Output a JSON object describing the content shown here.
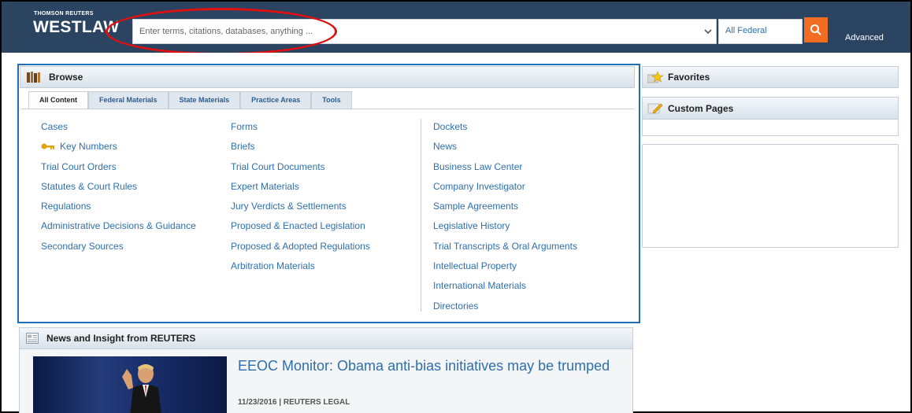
{
  "header": {
    "brand_top": "THOMSON REUTERS",
    "brand_main": "WESTLAW",
    "search_placeholder": "Enter terms, citations, databases, anything ...",
    "jurisdiction": "All Federal",
    "advanced_label": "Advanced",
    "colors": {
      "bar": "#2b4461",
      "search_button": "#f26d21",
      "annotation": "#e01010"
    }
  },
  "browse": {
    "title": "Browse",
    "tabs": [
      {
        "label": "All Content",
        "active": true
      },
      {
        "label": "Federal Materials",
        "active": false
      },
      {
        "label": "State Materials",
        "active": false
      },
      {
        "label": "Practice Areas",
        "active": false
      },
      {
        "label": "Tools",
        "active": false
      }
    ],
    "columns": [
      [
        "Cases",
        "Key Numbers",
        "Trial Court Orders",
        "Statutes & Court Rules",
        "Regulations",
        "Administrative Decisions & Guidance",
        "Secondary Sources"
      ],
      [
        "Forms",
        "Briefs",
        "Trial Court Documents",
        "Expert Materials",
        "Jury Verdicts & Settlements",
        "Proposed & Enacted Legislation",
        "Proposed & Adopted Regulations",
        "Arbitration Materials"
      ],
      [
        "Dockets",
        "News",
        "Business Law Center",
        "Company Investigator",
        "Sample Agreements",
        "Legislative History",
        "Trial Transcripts & Oral Arguments",
        "Intellectual Property",
        "International Materials",
        "Directories"
      ]
    ],
    "link_color": "#2e6fac",
    "frame_color": "#1f6fb5"
  },
  "sidebar": {
    "favorites_title": "Favorites",
    "custom_pages_title": "Custom Pages"
  },
  "news": {
    "section_title": "News and Insight from REUTERS",
    "headline": "EEOC Monitor: Obama anti-bias initiatives may be trumped",
    "meta": "11/23/2016 | REUTERS LEGAL"
  }
}
